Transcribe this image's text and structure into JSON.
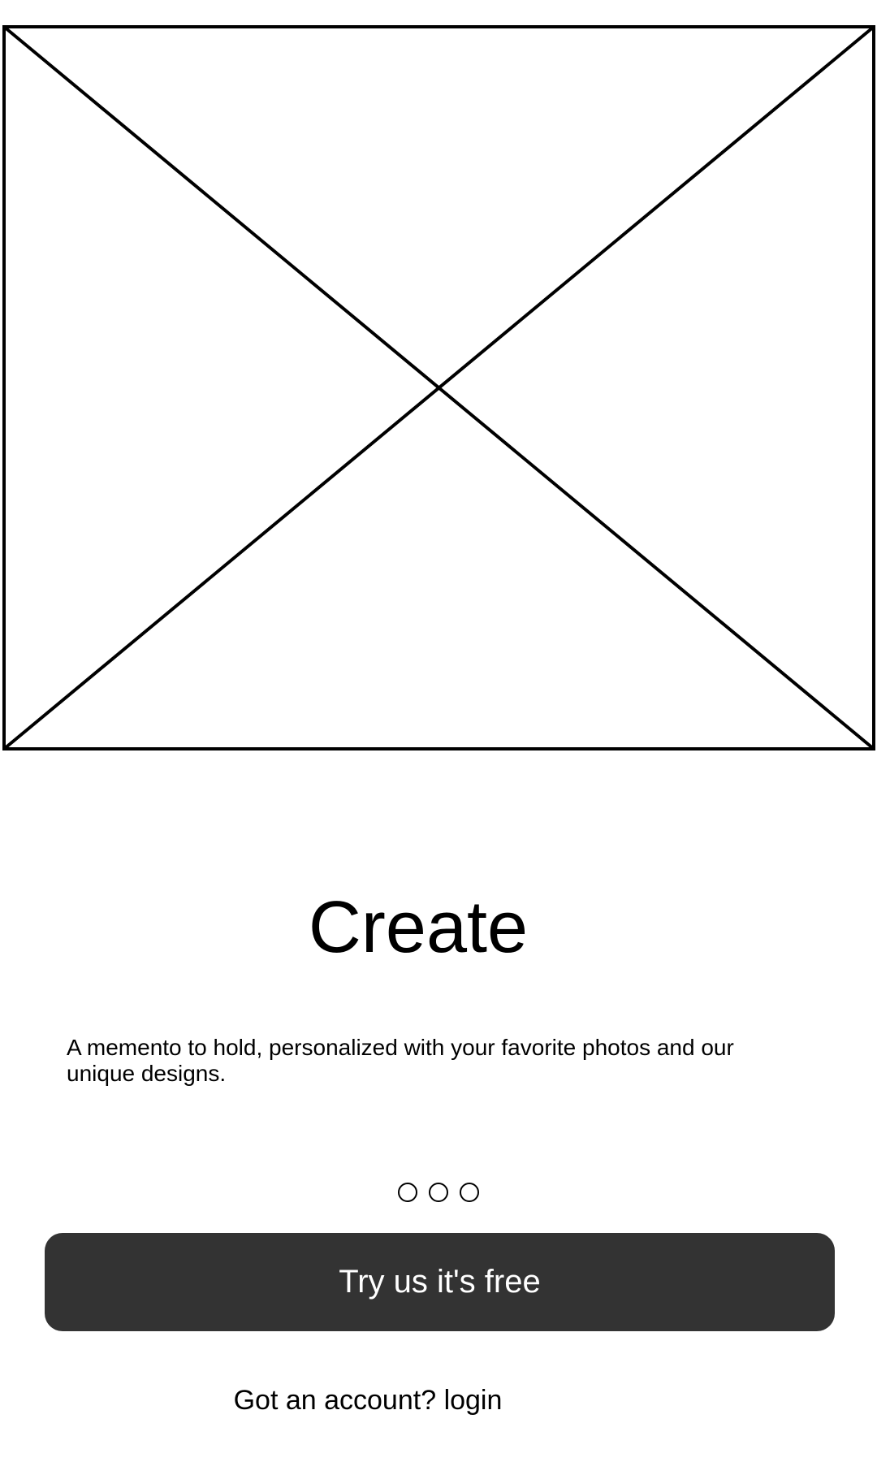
{
  "hero": {
    "image_icon": "image-placeholder-icon"
  },
  "onboarding": {
    "headline": "Create",
    "description": "A memento to hold, personalized with your favorite photos and our unique designs.",
    "pager": {
      "total": 3,
      "active_index": null
    }
  },
  "cta": {
    "primary_label": "Try us it's free",
    "login_prefix": "Got an account?",
    "login_link": "login"
  },
  "colors": {
    "button_bg": "#333333",
    "button_text": "#ffffff",
    "text": "#000000",
    "background": "#ffffff"
  }
}
